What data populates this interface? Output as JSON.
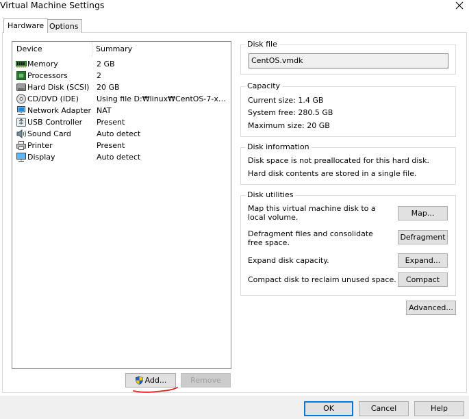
{
  "window": {
    "title": "Virtual Machine Settings"
  },
  "tabs": [
    {
      "label": "Hardware",
      "active": true
    },
    {
      "label": "Options",
      "active": false
    }
  ],
  "device_list": {
    "columns": [
      "Device",
      "Summary"
    ],
    "rows": [
      {
        "icon": "memory-icon",
        "device": "Memory",
        "summary": "2 GB"
      },
      {
        "icon": "processor-icon",
        "device": "Processors",
        "summary": "2"
      },
      {
        "icon": "hard-disk-icon",
        "device": "Hard Disk (SCSI)",
        "summary": "20 GB"
      },
      {
        "icon": "cd-dvd-icon",
        "device": "CD/DVD (IDE)",
        "summary": "Using file D:₩linux₩CentOS-7-x86_..."
      },
      {
        "icon": "network-adapter-icon",
        "device": "Network Adapter",
        "summary": "NAT"
      },
      {
        "icon": "usb-controller-icon",
        "device": "USB Controller",
        "summary": "Present"
      },
      {
        "icon": "sound-card-icon",
        "device": "Sound Card",
        "summary": "Auto detect"
      },
      {
        "icon": "printer-icon",
        "device": "Printer",
        "summary": "Present"
      },
      {
        "icon": "display-icon",
        "device": "Display",
        "summary": "Auto detect"
      }
    ],
    "add_label": "Add...",
    "remove_label": "Remove"
  },
  "disk_file": {
    "title": "Disk file",
    "value": "CentOS.vmdk"
  },
  "capacity": {
    "title": "Capacity",
    "current": "Current size:  1.4 GB",
    "free": "System free:  280.5 GB",
    "max": "Maximum size:  20 GB"
  },
  "disk_info": {
    "title": "Disk information",
    "line1": "Disk space is not preallocated for this hard disk.",
    "line2": "Hard disk contents are stored in a single file."
  },
  "disk_utilities": {
    "title": "Disk utilities",
    "map_desc": "Map this virtual machine disk to a local volume.",
    "map_label": "Map...",
    "defrag_desc": "Defragment files and consolidate free space.",
    "defrag_label": "Defragment",
    "expand_desc": "Expand disk capacity.",
    "expand_label": "Expand...",
    "compact_desc": "Compact disk to reclaim unused space.",
    "compact_label": "Compact"
  },
  "advanced_label": "Advanced...",
  "footer": {
    "ok": "OK",
    "cancel": "Cancel",
    "help": "Help"
  },
  "colors": {
    "accent": "#0078d7",
    "annotation": "#e02020"
  }
}
